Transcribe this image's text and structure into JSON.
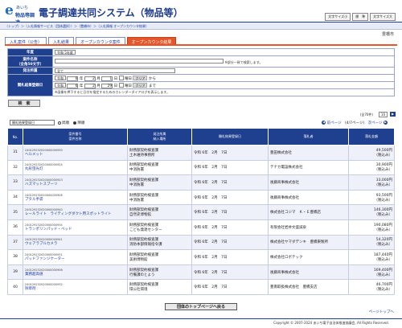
{
  "header": {
    "logo_mark": "e",
    "logo_line1": "あいち",
    "logo_line2": "物品等調達",
    "title": "電子調達共同システム（物品等）",
    "size_buttons": [
      "文字サイズ小",
      "標　準",
      "文字サイズ大"
    ]
  },
  "breadcrumb": "（トップ）＞（入札情報サービス（団体選択））＞（豊橋市）＞（入札情報 オープンカウンタ結果）",
  "city": "豊橋市",
  "tabs": [
    "入札案件（公告）",
    "入札結果",
    "オープンカウンタ案件",
    "オープンカウンタ結果"
  ],
  "search": {
    "rows": [
      {
        "label": "年度",
        "value": "令和 5年度"
      },
      {
        "label": "案件名称\n（全角50文字）",
        "value": "",
        "note": "※部分一致で検索します。"
      },
      {
        "label": "発注所属",
        "value": "全て"
      },
      {
        "label": "開札結果登録日",
        "from": {
          "era": "令和",
          "year": "6",
          "month": "2",
          "day": "1"
        },
        "to": {
          "era": "令和",
          "year": "6",
          "month": "2",
          "day": "29"
        },
        "from_suffix": "から",
        "to_suffix": "まで",
        "note": "※画像を押下すると日付を指定するためのカレンダーダイアログを表示します。",
        "clear": "クリア",
        "day_unit": "日",
        "month_unit": "月",
        "year_unit": "年",
        "weekday_unit": "曜日"
      }
    ],
    "button": "検　索"
  },
  "list": {
    "count": "(全70件)",
    "per_page": "10",
    "sort_select": "開札結果登録日",
    "radio_asc": "昇順",
    "radio_desc": "降順",
    "prev": "前ページ",
    "page": "(4/7ページ)",
    "next": "次ページ"
  },
  "columns": {
    "no": "No.",
    "anken": "案件番号\n案件名称",
    "shozoku": "発注所属\n納入場所",
    "date": "開札結果登録日",
    "winner": "落札者",
    "price": "落札金額"
  },
  "rows": [
    {
      "no": "31",
      "anken_no": "240129232020000000930",
      "anken_name": "ヘルメット",
      "shozoku": "財務部契約検査課",
      "place": "土木維持事務所",
      "date": "令和 6年　2月　7日",
      "winner": "豊田株式会社",
      "price": "49,500円",
      "tax": "（税込み）"
    },
    {
      "no": "32",
      "anken_no": "240129232020000000924",
      "anken_name": "丸形蛍光灯",
      "shozoku": "財務部契約検査課",
      "place": "中消防署",
      "date": "令和 6年　2月　7日",
      "winner": "テナカ電設株式会社",
      "price": "30,900円",
      "tax": "（税込み）"
    },
    {
      "no": "33",
      "anken_no": "240129232020000000923",
      "anken_name": "ハズマットスプーリ",
      "shozoku": "財務部契約検査課",
      "place": "中消防署",
      "date": "令和 6年　2月　7日",
      "winner": "後藤商事株式会社",
      "price": "33,000円",
      "tax": "（税込み）"
    },
    {
      "no": "34",
      "anken_no": "240129232020000000906",
      "anken_name": "ブタル手袋",
      "shozoku": "財務部契約検査課",
      "place": "中消防署",
      "date": "令和 6年　2月　7日",
      "winner": "後藤商事株式会社",
      "price": "93,500円",
      "tax": "（税込み）"
    },
    {
      "no": "35",
      "anken_no": "240129232020000000940",
      "anken_name": "レールライト　ライティングダクト用スポットライト",
      "shozoku": "財務部契約検査課",
      "place": "自然史博物館",
      "date": "令和 6年　2月　7日",
      "winner": "株式会社コジマ　Ｋ・Ｅ豊橋店",
      "price": "146,300円",
      "tax": "（税込み）"
    },
    {
      "no": "36",
      "anken_no": "240129232020000000934",
      "anken_name": "トランポリンパッド・ベッド",
      "shozoku": "財務部契約検査課",
      "place": "こども発達センター",
      "date": "令和 6年　2月　7日",
      "winner": "有限会社岩井文盛減泉",
      "price": "190,080円",
      "tax": "（税込み）"
    },
    {
      "no": "37",
      "anken_no": "240129232020000000941",
      "anken_name": "ウェアラブルカメラ",
      "shozoku": "財務部契約検査課",
      "place": "消防本部情報指令課",
      "date": "令和 6年　2月　7日",
      "winner": "株式会社ヤマダデンキ　豊橋東製所",
      "price": "54,320円",
      "tax": "（税込み）"
    },
    {
      "no": "38",
      "anken_no": "240129232020000000931",
      "anken_name": "パッドファンジケーター",
      "shozoku": "財務部契約検査課",
      "place": "美術博物館",
      "date": "令和 6年　2月　7日",
      "winner": "株式会社ロボテック",
      "price": "187,440円",
      "tax": "（税込み）"
    },
    {
      "no": "39",
      "anken_no": "240129232020000000906",
      "anken_name": "業務超高値",
      "shozoku": "財務部契約検査課",
      "place": "行備課のとよう",
      "date": "令和 6年　2月　7日",
      "winner": "後藤商事株式会社",
      "price": "169,400円",
      "tax": "（税込み）"
    },
    {
      "no": "40",
      "anken_no": "240129232020000000932",
      "anken_name": "除草剤",
      "shozoku": "財務部契約検査課",
      "place": "環公吐環境",
      "date": "令和 6年　2月　7日",
      "winner": "豊南取扱株式会社　豊橋支店",
      "price": "46,700円",
      "tax": "（税込み）"
    }
  ],
  "back_button": "団体のトップページへ戻る",
  "top_link": "ページトップへ",
  "copyright": "Copyright © 2007-2024 あいち電子自治体推進協議会, All Rights Reserved."
}
